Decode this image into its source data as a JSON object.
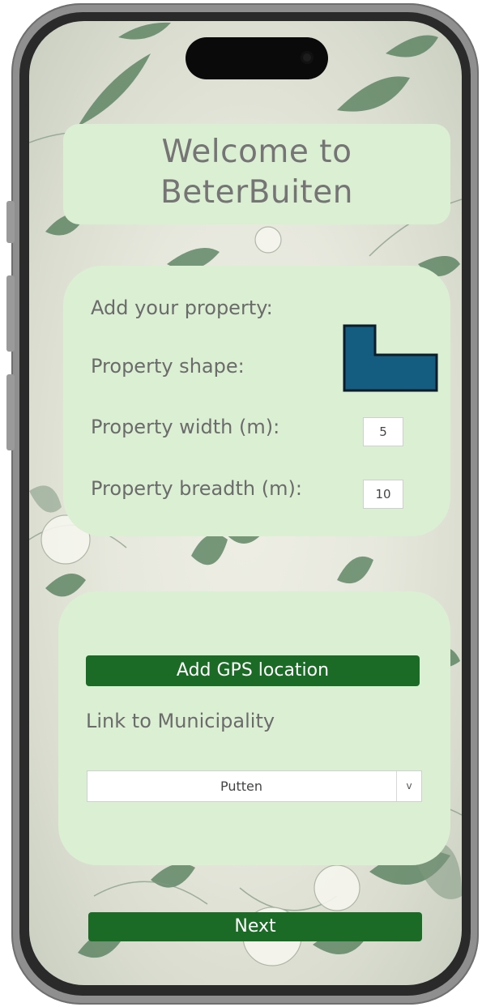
{
  "header": {
    "title_line1": "Welcome to",
    "title_line2": "BeterBuiten"
  },
  "property": {
    "heading": "Add your property:",
    "shape_label": "Property shape:",
    "width_label": "Property width (m):",
    "width_value": "5",
    "breadth_label": "Property breadth (m):",
    "breadth_value": "10",
    "shape_icon": "l-shape-icon"
  },
  "location": {
    "gps_button_label": "Add GPS location",
    "municipality_label": "Link to Municipality",
    "municipality_selected": "Putten",
    "dropdown_caret": "v"
  },
  "footer": {
    "next_label": "Next"
  },
  "colors": {
    "card_background": "#dbefd3",
    "button_green": "#1b6a25",
    "shape_fill": "#145d80",
    "text_gray": "#6b6b6b"
  }
}
